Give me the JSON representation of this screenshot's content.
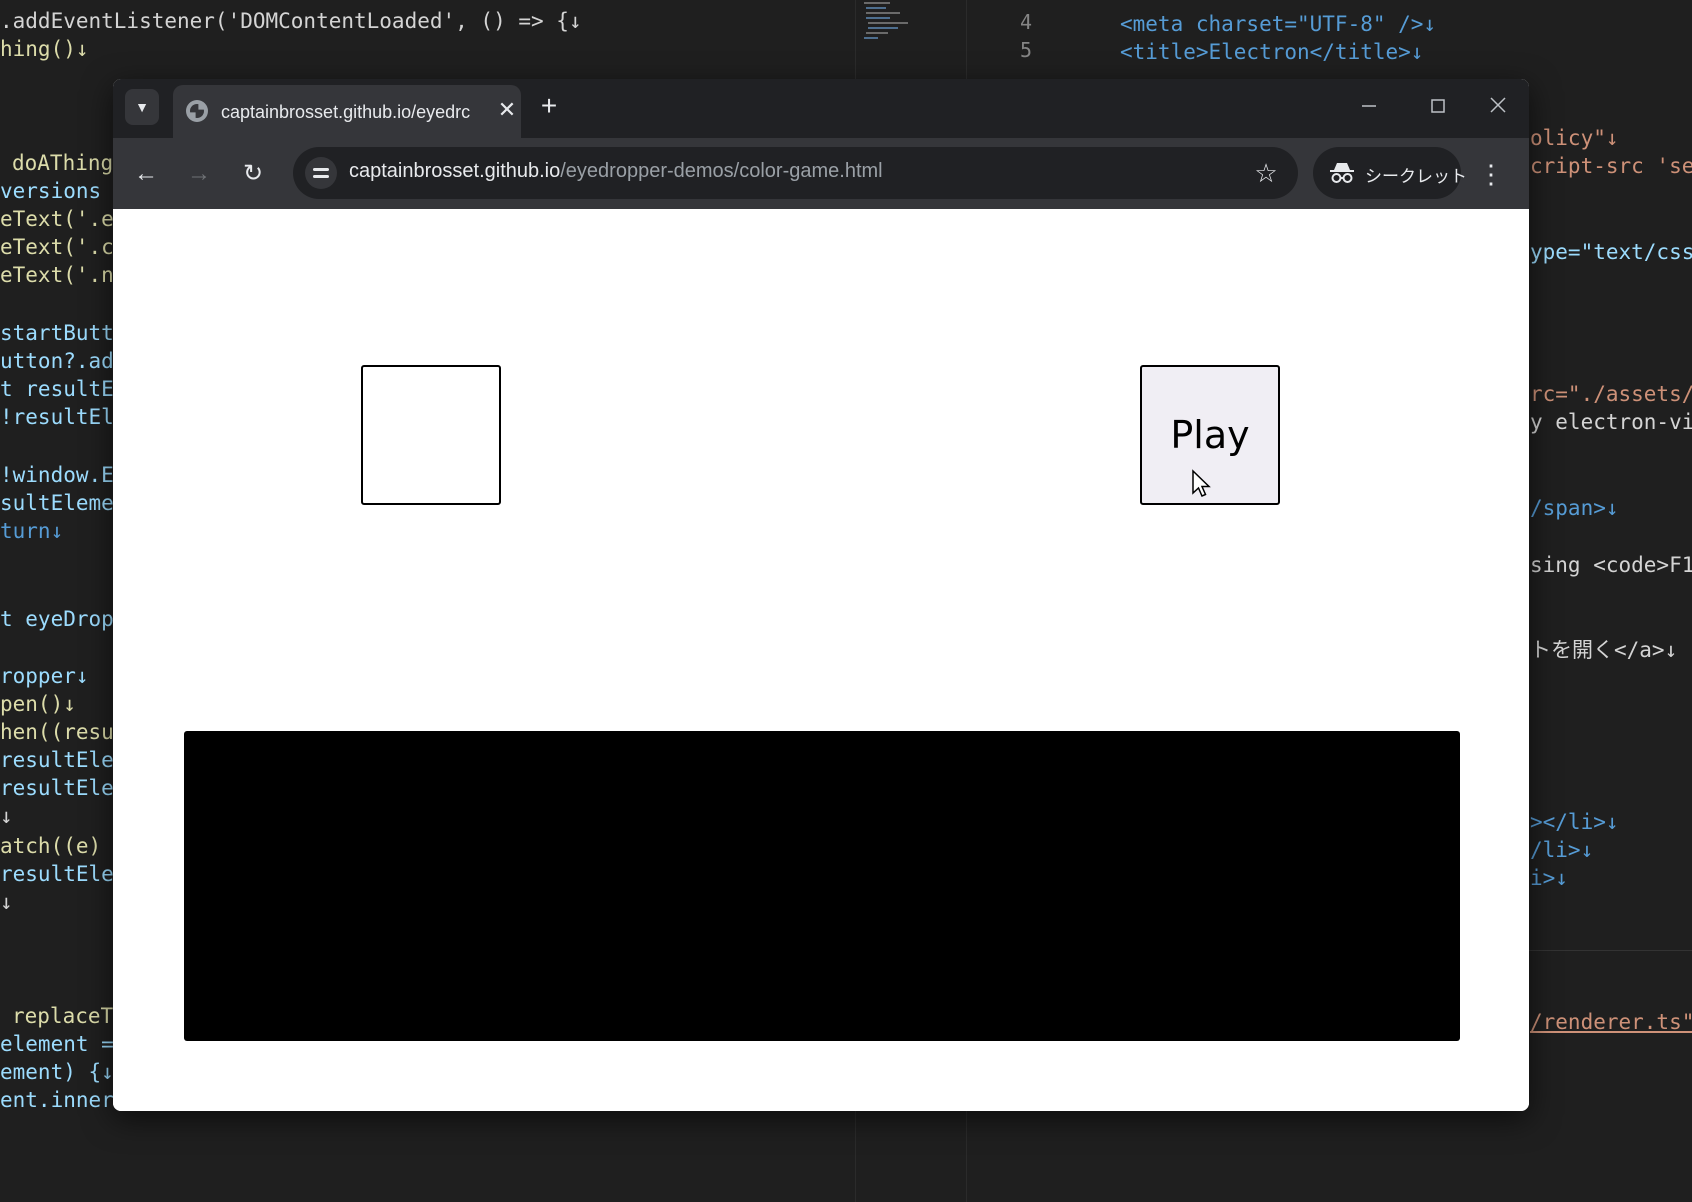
{
  "browser": {
    "tab": {
      "title": "captainbrosset.github.io/eyedrc",
      "close_glyph": "✕",
      "globe_icon": "globe-icon"
    },
    "new_tab_glyph": "+",
    "window_controls": {
      "minimize": "—",
      "maximize": "☐",
      "close": "✕"
    },
    "toolbar": {
      "back_glyph": "←",
      "forward_glyph": "→",
      "reload_glyph": "↻",
      "url_host": "captainbrosset.github.io",
      "url_path": "/eyedropper-demos/color-game.html",
      "star_glyph": "☆",
      "incognito_label": "シークレット",
      "menu_glyph": "⋮"
    }
  },
  "page": {
    "play_label": "Play",
    "result_color": "#000000",
    "target_color": "#ffffff"
  },
  "editor_left": [
    ".addEventListener('DOMContentLoaded', () => {↓",
    "hing()↓",
    "doAThing",
    "versions",
    "eText('.e",
    "eText('.c",
    "eText('.n",
    "startButt",
    "utton?.ad",
    "t resultE",
    "!resultEl",
    "!window.E",
    "sultEleme",
    "turn↓",
    "t eyeDrop",
    "ropper↓",
    "pen()↓",
    "hen((resu",
    "resultEle",
    "resultEle",
    "↓",
    "atch((e)",
    "resultEle",
    "↓",
    "replaceT",
    "element =",
    "ement) {↓",
    "ent.inner"
  ],
  "editor_right": [
    "<meta charset=\"UTF-8\" />↓",
    "<title>Electron</title>↓",
    "olicy\"↓",
    "cript-src 'se",
    "ype=\"text/css",
    "rc=\"./assets/",
    "y electron-vi",
    "/span>↓",
    "sing <code>F1",
    "トを開く</a>↓",
    "></li>↓",
    "/li>↓",
    "i>↓",
    "/renderer.ts\""
  ],
  "gutter_numbers": [
    "4",
    "5"
  ]
}
